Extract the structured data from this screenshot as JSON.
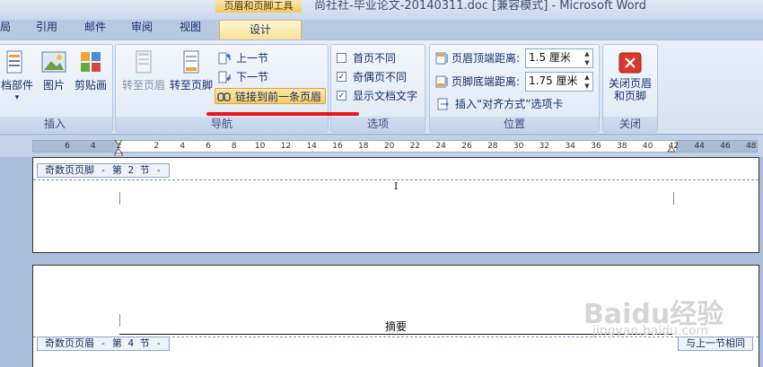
{
  "window": {
    "context_tool": "页眉和页脚工具",
    "title": "尚社社-毕业论文-20140311.doc [兼容模式] - Microsoft Word"
  },
  "tabs": {
    "layout_fragment": "局",
    "references": "引用",
    "mailings": "邮件",
    "review": "审阅",
    "view": "视图",
    "design": "设计"
  },
  "ribbon": {
    "insert_group": {
      "label": "插入",
      "docparts": "档部件",
      "picture": "图片",
      "clipart": "剪贴画"
    },
    "navigation_group": {
      "label": "导航",
      "goto_header": "转至页眉",
      "goto_footer": "转至页脚",
      "previous_section": "上一节",
      "next_section": "下一节",
      "link_to_previous": "链接到前一条页眉"
    },
    "options_group": {
      "label": "选项",
      "different_first": {
        "label": "首页不同",
        "checked": false
      },
      "different_odd_even": {
        "label": "奇偶页不同",
        "checked": true
      },
      "show_doc_text": {
        "label": "显示文档文字",
        "checked": true
      }
    },
    "position_group": {
      "label": "位置",
      "header_from_top_label": "页眉顶端距离:",
      "header_from_top_value": "1.5 厘米",
      "footer_from_bottom_label": "页脚底端距离:",
      "footer_from_bottom_value": "1.75 厘米",
      "insert_align_tab": "插入“对齐方式”选项卡"
    },
    "close_group": {
      "label": "关闭",
      "close_button_line1": "关闭页眉",
      "close_button_line2": "和页脚"
    }
  },
  "ruler": {
    "ticks": [
      "6",
      "4",
      "2",
      "2",
      "4",
      "6",
      "8",
      "10",
      "12",
      "14",
      "16",
      "18",
      "20",
      "22",
      "24",
      "26",
      "28",
      "30",
      "32",
      "34",
      "36",
      "38",
      "40",
      "42",
      "44",
      "46",
      "48"
    ]
  },
  "document": {
    "page1_footer_tag": "奇数页页脚 - 第 2 节 -",
    "page2_header_tag": "奇数页页眉 - 第 4 节 -",
    "same_as_previous": "与上一节相同",
    "body_heading": "摘要",
    "cursor_glyph": "I"
  },
  "overlay": {
    "watermark_text": "Baidu经验",
    "watermark_url": "jingyan.baidu.com"
  },
  "colors": {
    "annotation_line": "#e8141c",
    "ribbon_bg": "#dfe8f4",
    "doc_background": "#a9bedb"
  }
}
